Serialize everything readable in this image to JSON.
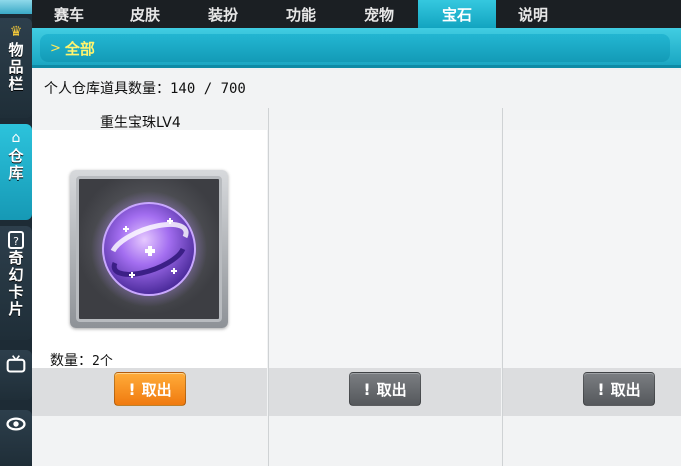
{
  "sidebar": {
    "items": [
      {
        "label": "物品栏",
        "icon": "crown-icon"
      },
      {
        "label": "仓库",
        "icon": "home-icon"
      },
      {
        "label": "奇幻卡片",
        "icon": "question-card-icon"
      },
      {
        "label": "",
        "icon": "tv-icon"
      },
      {
        "label": "",
        "icon": "eye-icon"
      }
    ]
  },
  "tabs": [
    {
      "label": "赛车"
    },
    {
      "label": "皮肤"
    },
    {
      "label": "装扮"
    },
    {
      "label": "功能"
    },
    {
      "label": "宠物"
    },
    {
      "label": "宝石",
      "active": true
    },
    {
      "label": "说明"
    }
  ],
  "breadcrumb": {
    "label": "全部"
  },
  "storage": {
    "label": "个人仓库道具数量：",
    "count": "140 / 700"
  },
  "slots": [
    {
      "name": "重生宝珠LV4",
      "qty_label": "数量：",
      "qty_value": "2个",
      "button": "取出",
      "button_state": "active",
      "icon": "rebirth-orb-icon"
    },
    {
      "name": "",
      "button": "取出",
      "button_state": "disabled"
    },
    {
      "name": "",
      "button": "取出",
      "button_state": "disabled"
    }
  ],
  "colors": {
    "accent": "#1aa6c2",
    "breadcrumb_text": "#fff46e",
    "button_active": "#f07a0f",
    "button_disabled": "#55585c"
  }
}
